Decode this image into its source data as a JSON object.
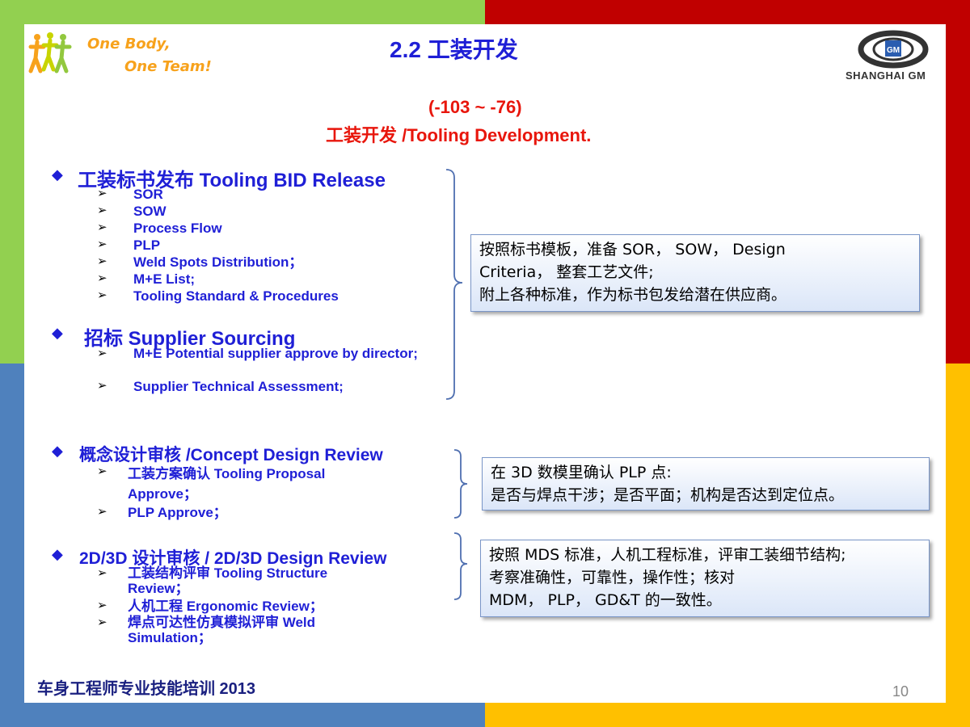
{
  "logo": {
    "line1": "One Body,",
    "line2": "One Team!"
  },
  "title": "2.2  工装开发",
  "brand": {
    "name": "SHANGHAI GM",
    "emblem": "GM"
  },
  "subtitle": {
    "range": "(-103 ~ -76)",
    "cn": "工装开发",
    "en": " /Tooling Development."
  },
  "sections": [
    {
      "heading": "工装标书发布 Tooling BID Release",
      "items": [
        "SOR",
        "SOW",
        "Process Flow",
        "PLP",
        "Weld Spots Distribution；",
        "M+E List;",
        "Tooling Standard & Procedures"
      ]
    },
    {
      "heading": "招标 Supplier Sourcing",
      "items": [
        "M+E Potential  supplier approve by director;",
        "Supplier Technical Assessment;"
      ]
    },
    {
      "heading": "概念设计审核 /Concept Design Review",
      "items": [
        "工装方案确认 Tooling Proposal Approve；",
        "PLP Approve；"
      ]
    },
    {
      "heading": "2D/3D 设计审核 / 2D/3D Design Review",
      "items": [
        "工装结构评审 Tooling Structure Review；",
        "人机工程 Ergonomic  Review；",
        "焊点可达性仿真模拟评审 Weld Simulation；"
      ]
    }
  ],
  "notes": [
    {
      "lines": [
        "按照标书模板，准备 SOR，   SOW，  Design",
        "Criteria， 整套工艺文件;",
        "附上各种标准，作为标书包发给潜在供应商。"
      ]
    },
    {
      "lines": [
        "在 3D 数模里确认 PLP 点:",
        "是否与焊点干涉；是否平面；机构是否达到定位点。"
      ]
    },
    {
      "lines": [
        "按照 MDS 标准，人机工程标准，评审工装细节结构;",
        "考察准确性，可靠性，操作性；核对",
        "MDM，  PLP，  GD&T 的一致性。"
      ]
    }
  ],
  "footer": "车身工程师专业技能培训 2013",
  "page_number": "10",
  "colors": {
    "green": "#92d050",
    "red": "#c00000",
    "blue": "#4f81bd",
    "yellow": "#ffc000",
    "text_blue": "#1f1fd6",
    "text_red": "#e8160c"
  }
}
